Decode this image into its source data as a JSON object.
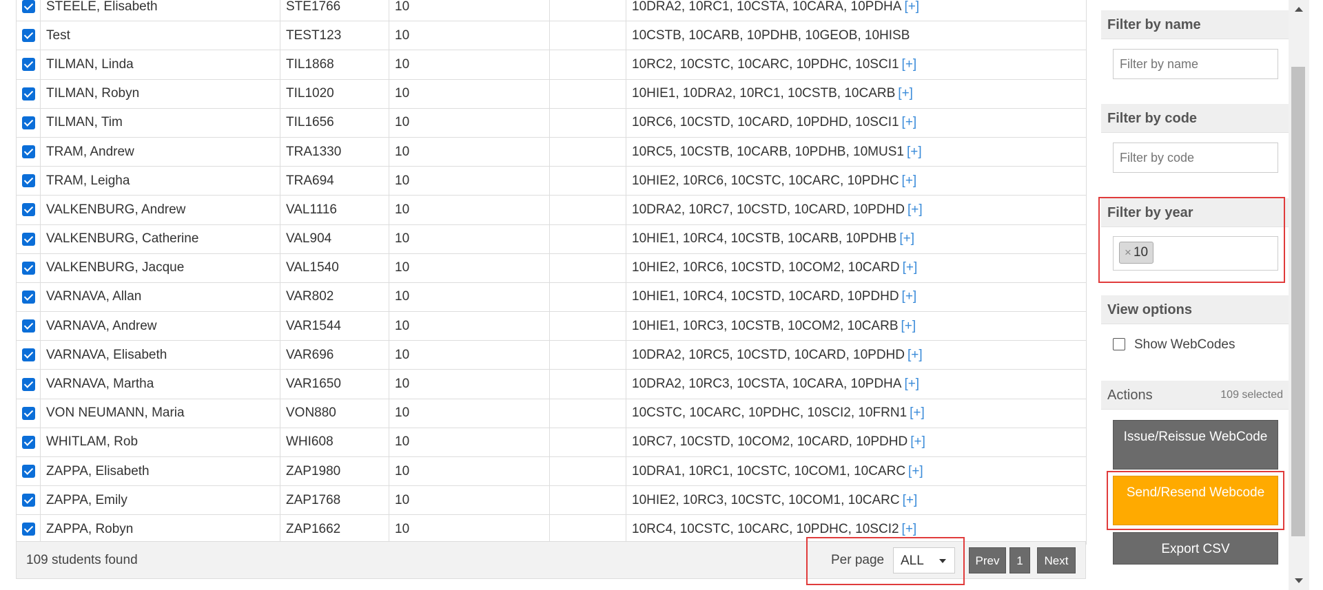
{
  "rows": [
    {
      "name": "STEELE, Elisabeth",
      "code": "STE1766",
      "year": "10",
      "classes": "10DRA2, 10RC1, 10CSTA, 10CARA, 10PDHA",
      "more": "[+]"
    },
    {
      "name": "Test",
      "code": "TEST123",
      "year": "10",
      "classes": "10CSTB, 10CARB, 10PDHB, 10GEOB, 10HISB",
      "more": ""
    },
    {
      "name": "TILMAN, Linda",
      "code": "TIL1868",
      "year": "10",
      "classes": "10RC2, 10CSTC, 10CARC, 10PDHC, 10SCI1",
      "more": "[+]"
    },
    {
      "name": "TILMAN, Robyn",
      "code": "TIL1020",
      "year": "10",
      "classes": "10HIE1, 10DRA2, 10RC1, 10CSTB, 10CARB",
      "more": "[+]"
    },
    {
      "name": "TILMAN, Tim",
      "code": "TIL1656",
      "year": "10",
      "classes": "10RC6, 10CSTD, 10CARD, 10PDHD, 10SCI1",
      "more": "[+]"
    },
    {
      "name": "TRAM, Andrew",
      "code": "TRA1330",
      "year": "10",
      "classes": "10RC5, 10CSTB, 10CARB, 10PDHB, 10MUS1",
      "more": "[+]"
    },
    {
      "name": "TRAM, Leigha",
      "code": "TRA694",
      "year": "10",
      "classes": "10HIE2, 10RC6, 10CSTC, 10CARC, 10PDHC",
      "more": "[+]"
    },
    {
      "name": "VALKENBURG, Andrew",
      "code": "VAL1116",
      "year": "10",
      "classes": "10DRA2, 10RC7, 10CSTD, 10CARD, 10PDHD",
      "more": "[+]"
    },
    {
      "name": "VALKENBURG, Catherine",
      "code": "VAL904",
      "year": "10",
      "classes": "10HIE1, 10RC4, 10CSTB, 10CARB, 10PDHB",
      "more": "[+]"
    },
    {
      "name": "VALKENBURG, Jacque",
      "code": "VAL1540",
      "year": "10",
      "classes": "10HIE2, 10RC6, 10CSTD, 10COM2, 10CARD",
      "more": "[+]"
    },
    {
      "name": "VARNAVA, Allan",
      "code": "VAR802",
      "year": "10",
      "classes": "10HIE1, 10RC4, 10CSTD, 10CARD, 10PDHD",
      "more": "[+]"
    },
    {
      "name": "VARNAVA, Andrew",
      "code": "VAR1544",
      "year": "10",
      "classes": "10HIE1, 10RC3, 10CSTB, 10COM2, 10CARB",
      "more": "[+]"
    },
    {
      "name": "VARNAVA, Elisabeth",
      "code": "VAR696",
      "year": "10",
      "classes": "10DRA2, 10RC5, 10CSTD, 10CARD, 10PDHD",
      "more": "[+]"
    },
    {
      "name": "VARNAVA, Martha",
      "code": "VAR1650",
      "year": "10",
      "classes": "10DRA2, 10RC3, 10CSTA, 10CARA, 10PDHA",
      "more": "[+]"
    },
    {
      "name": "VON NEUMANN, Maria",
      "code": "VON880",
      "year": "10",
      "classes": "10CSTC, 10CARC, 10PDHC, 10SCI2, 10FRN1",
      "more": "[+]"
    },
    {
      "name": "WHITLAM, Rob",
      "code": "WHI608",
      "year": "10",
      "classes": "10RC7, 10CSTD, 10COM2, 10CARD, 10PDHD",
      "more": "[+]"
    },
    {
      "name": "ZAPPA, Elisabeth",
      "code": "ZAP1980",
      "year": "10",
      "classes": "10DRA1, 10RC1, 10CSTC, 10COM1, 10CARC",
      "more": "[+]"
    },
    {
      "name": "ZAPPA, Emily",
      "code": "ZAP1768",
      "year": "10",
      "classes": "10HIE2, 10RC3, 10CSTC, 10COM1, 10CARC",
      "more": "[+]"
    },
    {
      "name": "ZAPPA, Robyn",
      "code": "ZAP1662",
      "year": "10",
      "classes": "10RC4, 10CSTC, 10CARC, 10PDHC, 10SCI2",
      "more": "[+]"
    }
  ],
  "footer": {
    "students_found": "109 students found",
    "per_page_label": "Per page",
    "per_page_value": "ALL",
    "prev": "Prev",
    "page": "1",
    "next": "Next"
  },
  "sidebar": {
    "filter_name_title": "Filter by name",
    "filter_name_placeholder": "Filter by name",
    "filter_code_title": "Filter by code",
    "filter_code_placeholder": "Filter by code",
    "filter_year_title": "Filter by year",
    "year_tag_remove": "×",
    "year_tag": "10",
    "view_options_title": "View options",
    "show_webcodes_label": "Show WebCodes",
    "actions_title": "Actions",
    "selected_count": "109 selected",
    "issue_button": "Issue/Reissue WebCode",
    "send_button": "Send/Resend Webcode",
    "export_button": "Export CSV"
  },
  "colors": {
    "checkbox": "#0b6ed8",
    "button_gray": "#6b6b6b",
    "send_button": "#ffaa00",
    "highlight_box": "#e03b3b",
    "more_link": "#3a8bd9"
  }
}
